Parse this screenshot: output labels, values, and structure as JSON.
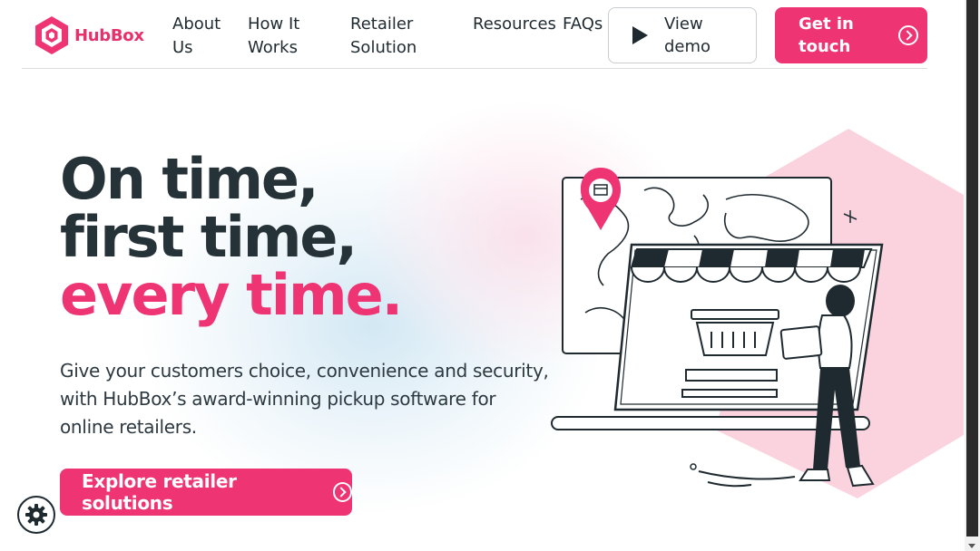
{
  "brand": {
    "name": "HubBox",
    "accent": "#ee3472",
    "text": "#253238"
  },
  "nav": {
    "items": [
      {
        "lines": [
          "About",
          "Us"
        ]
      },
      {
        "lines": [
          "How It",
          "Works"
        ]
      },
      {
        "lines": [
          "Retailer",
          "Solution"
        ]
      },
      {
        "lines": [
          "Resources"
        ]
      },
      {
        "lines": [
          "FAQs"
        ]
      }
    ],
    "demo": {
      "lines": [
        "View",
        "demo"
      ],
      "icon": "play-icon"
    },
    "cta": {
      "lines": [
        "Get in",
        "touch"
      ],
      "icon": "circle-arrow-right-icon"
    }
  },
  "hero": {
    "title": [
      "On time,",
      "first time,",
      "every time."
    ],
    "subtitle": "Give your customers choice, convenience and security, with HubBox’s award-winning pickup software for online retailers.",
    "button": {
      "label": "Explore retailer solutions",
      "icon": "circle-arrow-right-icon"
    }
  },
  "widgets": {
    "settings_icon": "gear-icon"
  }
}
